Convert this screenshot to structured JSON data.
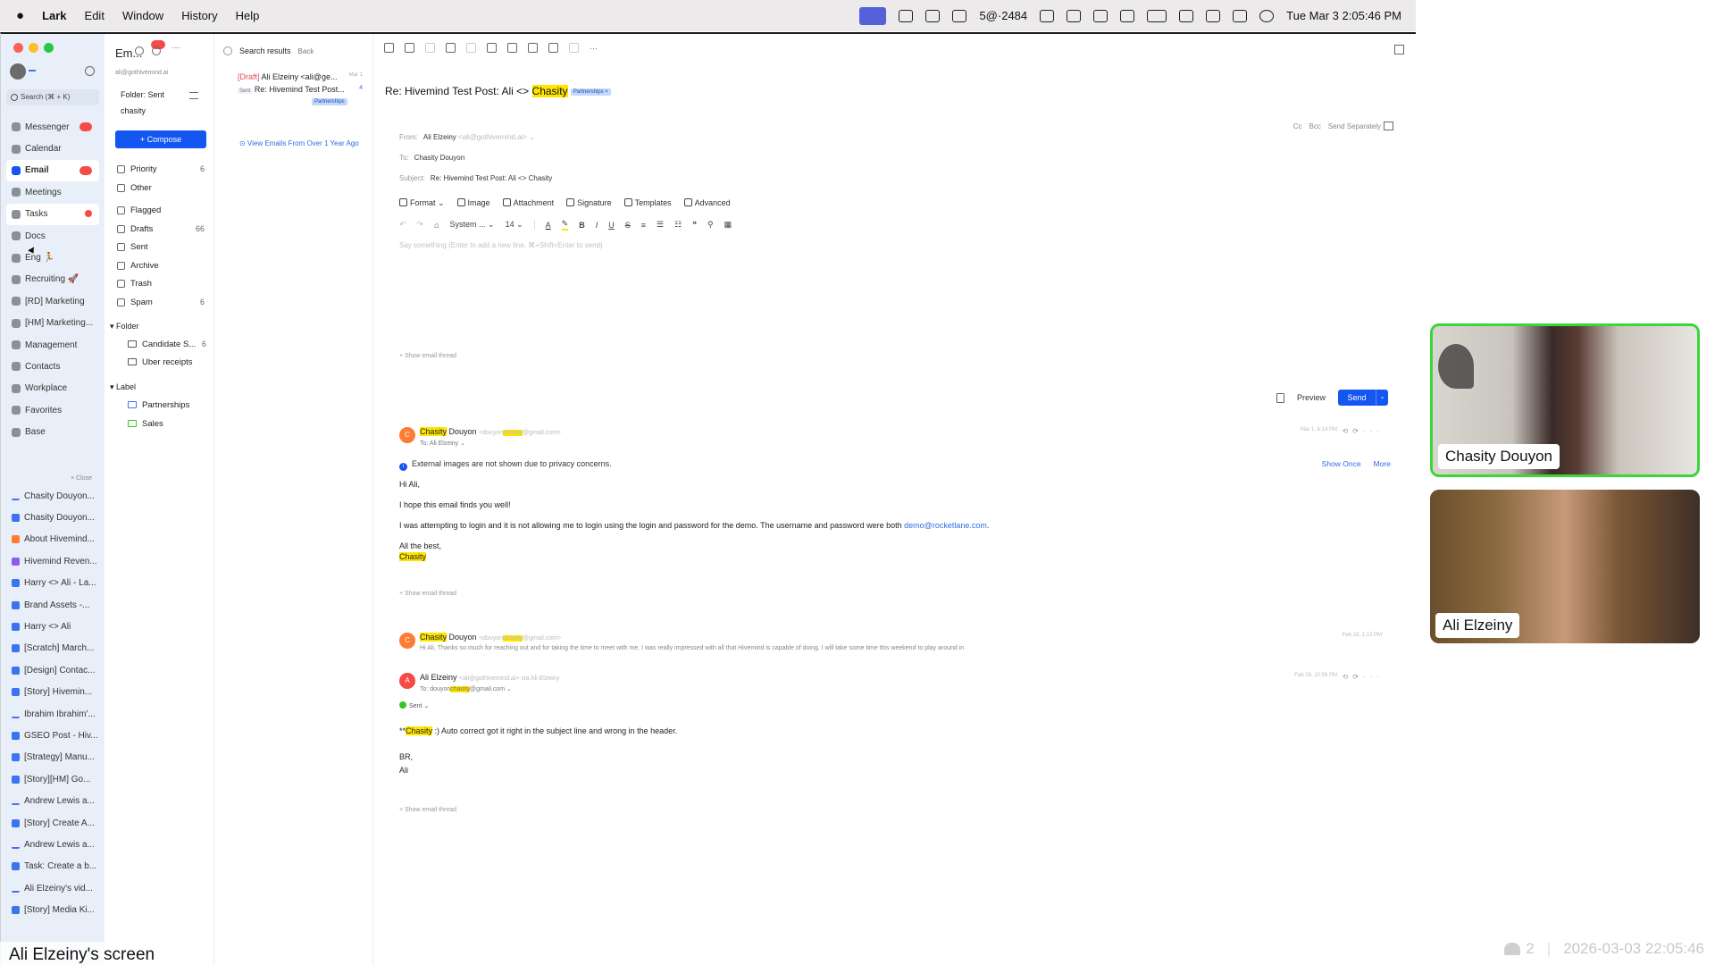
{
  "menubar": {
    "app": "Lark",
    "items": [
      "Edit",
      "Window",
      "History",
      "Help"
    ],
    "status_text": "5@·2484",
    "datetime": "Tue Mar 3  2:05:46 PM"
  },
  "nav": {
    "search_placeholder": "Search (⌘ + K)",
    "items": [
      {
        "label": "Messenger",
        "icon": "messenger-icon",
        "badge": true
      },
      {
        "label": "Calendar",
        "icon": "calendar-icon"
      },
      {
        "label": "Email",
        "icon": "email-icon",
        "badge": true,
        "active": true
      },
      {
        "label": "Meetings",
        "icon": "meetings-icon"
      },
      {
        "label": "Tasks",
        "icon": "tasks-icon",
        "badge": true
      },
      {
        "label": "Docs",
        "icon": "docs-icon"
      },
      {
        "label": "Eng 🏃",
        "icon": "group-icon"
      },
      {
        "label": "Recruiting 🚀",
        "icon": "group-icon"
      },
      {
        "label": "[RD] Marketing",
        "icon": "group-icon"
      },
      {
        "label": "[HM] Marketing...",
        "icon": "group-icon"
      },
      {
        "label": "Management",
        "icon": "group-icon"
      },
      {
        "label": "Contacts",
        "icon": "contacts-icon"
      },
      {
        "label": "Workplace",
        "icon": "workplace-icon"
      },
      {
        "label": "Favorites",
        "icon": "star-icon"
      },
      {
        "label": "Base",
        "icon": "base-icon"
      }
    ],
    "close_label": "× Close",
    "docs": [
      {
        "label": "Chasity Douyon...",
        "type": "wave"
      },
      {
        "label": "Chasity Douyon...",
        "type": "blue"
      },
      {
        "label": "About Hivemind...",
        "type": "orange"
      },
      {
        "label": "Hivemind Reven...",
        "type": "purple"
      },
      {
        "label": "Harry <> Ali - La...",
        "type": "blue"
      },
      {
        "label": "Brand Assets -...",
        "type": "blue"
      },
      {
        "label": "Harry <> Ali",
        "type": "blue"
      },
      {
        "label": "[Scratch] March...",
        "type": "blue"
      },
      {
        "label": "[Design] Contac...",
        "type": "blue"
      },
      {
        "label": "[Story] Hivemin...",
        "type": "blue"
      },
      {
        "label": "Ibrahim Ibrahim'...",
        "type": "wave"
      },
      {
        "label": "GSEO Post - Hiv...",
        "type": "blue"
      },
      {
        "label": "[Strategy] Manu...",
        "type": "blue"
      },
      {
        "label": "[Story][HM] Go...",
        "type": "blue"
      },
      {
        "label": "Andrew Lewis a...",
        "type": "wave"
      },
      {
        "label": "[Story] Create A...",
        "type": "blue"
      },
      {
        "label": "Andrew Lewis a...",
        "type": "wave"
      },
      {
        "label": "Task: Create a b...",
        "type": "blue"
      },
      {
        "label": "Ali Elzeiny's vid...",
        "type": "wave"
      },
      {
        "label": "[Story] Media Ki...",
        "type": "blue"
      }
    ],
    "screen_label": "Ali Elzeiny's screen"
  },
  "folders": {
    "title": "Em...",
    "address": "ali@gothivemind.ai",
    "current_folder": "Folder: Sent",
    "query": "chasity",
    "compose_label": "+ Compose",
    "items": [
      {
        "label": "Priority",
        "count": "6"
      },
      {
        "label": "Other",
        "count": ""
      },
      {
        "label": "Flagged",
        "count": ""
      },
      {
        "label": "Drafts",
        "count": "66"
      },
      {
        "label": "Sent",
        "count": ""
      },
      {
        "label": "Archive",
        "count": ""
      },
      {
        "label": "Trash",
        "count": ""
      },
      {
        "label": "Spam",
        "count": "6"
      }
    ],
    "folder_section": "Folder",
    "subfolders": [
      {
        "label": "Candidate S...",
        "count": "6"
      },
      {
        "label": "Uber receipts",
        "count": ""
      }
    ],
    "label_section": "Label",
    "labels": [
      {
        "label": "Partnerships"
      },
      {
        "label": "Sales"
      }
    ]
  },
  "results": {
    "title": "Search results",
    "back": "Back",
    "row1_draft": "[Draft]",
    "row1_text": "Ali Elzeiny <ali@ge...",
    "row1_date": "Mar 1",
    "row2_sent": "Sent",
    "row2_text": "Re: Hivemind Test Post...",
    "row2_count": "4",
    "tag": "Partnerships",
    "older_link": "⊙ View Emails From Over 1 Year Ago"
  },
  "compose": {
    "subject_prefix": "Re: Hivemind Test Post: Ali <> ",
    "subject_highlight": "Chasity",
    "subject_tag": "Partnerships ×",
    "from_label": "From:",
    "from_value": "Ali Elzeiny",
    "from_addr": "<ali@gothivemind.ai> ⌄",
    "to_label": "To:",
    "to_value": "Chasity Douyon",
    "subject_label": "Subject:",
    "subject_value": "Re: Hivemind Test Post: Ali <> Chasity",
    "cc": "Cc",
    "bcc": "Bcc",
    "send_separately": "Send Separately",
    "format_items": [
      "Format ⌄",
      "Image",
      "Attachment",
      "Signature",
      "Templates",
      "Advanced"
    ],
    "font_name": "System ...",
    "font_size": "14",
    "placeholder": "Say something (Enter to add a new line, ⌘+Shift+Enter to send)",
    "show_thread": "+ Show email thread",
    "preview": "Preview",
    "send": "Send"
  },
  "thread": {
    "msg1": {
      "avatar": "C",
      "name_hl": "Chasity",
      "name_rest": " Douyon",
      "addr_pre": "<douyon",
      "addr_hl": "chasity",
      "addr_post": "@gmail.com>",
      "to": "To: Ali Elzeiny ⌄",
      "date": "Mar 1, 6:14 PM",
      "notice": "External images are not shown due to privacy concerns.",
      "show_once": "Show Once",
      "more": "More",
      "greeting": "Hi Ali,",
      "line1": "I hope this email finds you well!",
      "line2": "I was attempting to login and it is not allowing me to login using the login and password for the demo. The username and password were both ",
      "line2_link": "demo@rocketlane.com",
      "line2_end": ".",
      "signoff": "All the best,",
      "signature": "Chasity"
    },
    "msg2": {
      "avatar": "C",
      "name_hl": "Chasity",
      "name_rest": " Douyon",
      "addr_pre": "<douyon",
      "addr_hl": "chasity",
      "addr_post": "@gmail.com>",
      "date": "Feb 28, 1:13 PM",
      "preview": "Hi Ali, Thanks so much for reaching out and for taking the time to meet with me. I was really impressed with all that Hivemind is capable of doing. I will take some time this weekend to play around in"
    },
    "msg3": {
      "avatar": "A",
      "name": "Ali Elzeiny",
      "addr": "<ali@gothivemind.ai> via Ali Elzeiny",
      "to_pre": "To: douyon",
      "to_hl": "chasity",
      "to_post": "@gmail.com ⌄",
      "date": "Feb 26, 10:58 PM",
      "sent": "Sent ⌄",
      "line1_pre": "**",
      "line1_hl": "Chasity",
      "line1_post": " :) Auto correct got it right in the subject line and wrong in the header.",
      "br": "BR,",
      "sig": "Ali"
    }
  },
  "video": {
    "tile1_name": "Chasity Douyon",
    "tile2_name": "Ali Elzeiny",
    "participants": "2",
    "timestamp": "2026-03-03 22:05:46"
  },
  "colors": {
    "accent": "#1456f0",
    "highlight": "#ffe500",
    "badge": "#f54a45",
    "speaker_border": "#3ad63a"
  }
}
